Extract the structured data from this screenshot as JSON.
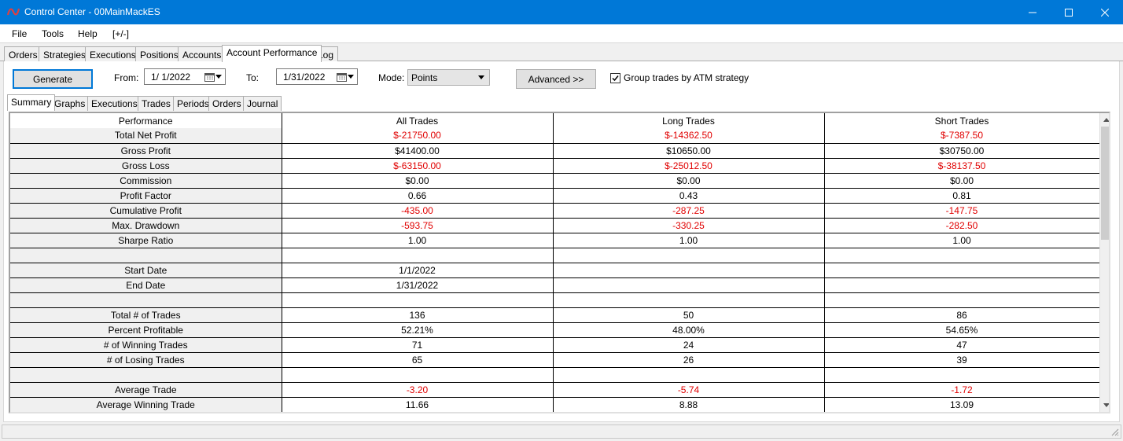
{
  "window": {
    "title": "Control Center - 00MainMackES",
    "minimize": "—",
    "maximize": "☐",
    "close": "✕",
    "accent": "#0078d7"
  },
  "menu": [
    "File",
    "Tools",
    "Help",
    "[+/-]"
  ],
  "main_tabs": [
    "Orders",
    "Strategies",
    "Executions",
    "Positions",
    "Accounts",
    "Account Performance",
    "Log"
  ],
  "active_main_tab": "Account Performance",
  "toolbar": {
    "generate": "Generate",
    "from_label": "From:",
    "from_value": "1/  1/2022",
    "to_label": "To:",
    "to_value": "1/31/2022",
    "mode_label": "Mode:",
    "mode_value": "Points",
    "advanced": "Advanced >>",
    "group_label": "Group trades by ATM strategy",
    "group_checked": true
  },
  "sub_tabs": [
    "Summary",
    "Graphs",
    "Executions",
    "Trades",
    "Periods",
    "Orders",
    "Journal"
  ],
  "active_sub_tab": "Summary",
  "table": {
    "columns": [
      "Performance",
      "All Trades",
      "Long Trades",
      "Short Trades"
    ],
    "negative_color": "#e00000",
    "rows": [
      {
        "label": "Total Net Profit",
        "values": [
          "$-21750.00",
          "$-14362.50",
          "$-7387.50"
        ],
        "neg": true
      },
      {
        "label": "Gross Profit",
        "values": [
          "$41400.00",
          "$10650.00",
          "$30750.00"
        ],
        "neg": false
      },
      {
        "label": "Gross Loss",
        "values": [
          "$-63150.00",
          "$-25012.50",
          "$-38137.50"
        ],
        "neg": true
      },
      {
        "label": "Commission",
        "values": [
          "$0.00",
          "$0.00",
          "$0.00"
        ],
        "neg": false
      },
      {
        "label": "Profit Factor",
        "values": [
          "0.66",
          "0.43",
          "0.81"
        ],
        "neg": false
      },
      {
        "label": "Cumulative Profit",
        "values": [
          "-435.00",
          "-287.25",
          "-147.75"
        ],
        "neg": true
      },
      {
        "label": "Max. Drawdown",
        "values": [
          "-593.75",
          "-330.25",
          "-282.50"
        ],
        "neg": true
      },
      {
        "label": "Sharpe Ratio",
        "values": [
          "1.00",
          "1.00",
          "1.00"
        ],
        "neg": false
      },
      {
        "label": "",
        "values": [
          "",
          "",
          ""
        ],
        "neg": false
      },
      {
        "label": "Start Date",
        "values": [
          "1/1/2022",
          "",
          ""
        ],
        "neg": false
      },
      {
        "label": "End Date",
        "values": [
          "1/31/2022",
          "",
          ""
        ],
        "neg": false
      },
      {
        "label": "",
        "values": [
          "",
          "",
          ""
        ],
        "neg": false
      },
      {
        "label": "Total # of Trades",
        "values": [
          "136",
          "50",
          "86"
        ],
        "neg": false
      },
      {
        "label": "Percent Profitable",
        "values": [
          "52.21%",
          "48.00%",
          "54.65%"
        ],
        "neg": false
      },
      {
        "label": "# of Winning Trades",
        "values": [
          "71",
          "24",
          "47"
        ],
        "neg": false
      },
      {
        "label": "# of Losing Trades",
        "values": [
          "65",
          "26",
          "39"
        ],
        "neg": false
      },
      {
        "label": "",
        "values": [
          "",
          "",
          ""
        ],
        "neg": false
      },
      {
        "label": "Average Trade",
        "values": [
          "-3.20",
          "-5.74",
          "-1.72"
        ],
        "neg": true
      },
      {
        "label": "Average Winning Trade",
        "values": [
          "11.66",
          "8.88",
          "13.09"
        ],
        "neg": false
      }
    ]
  }
}
